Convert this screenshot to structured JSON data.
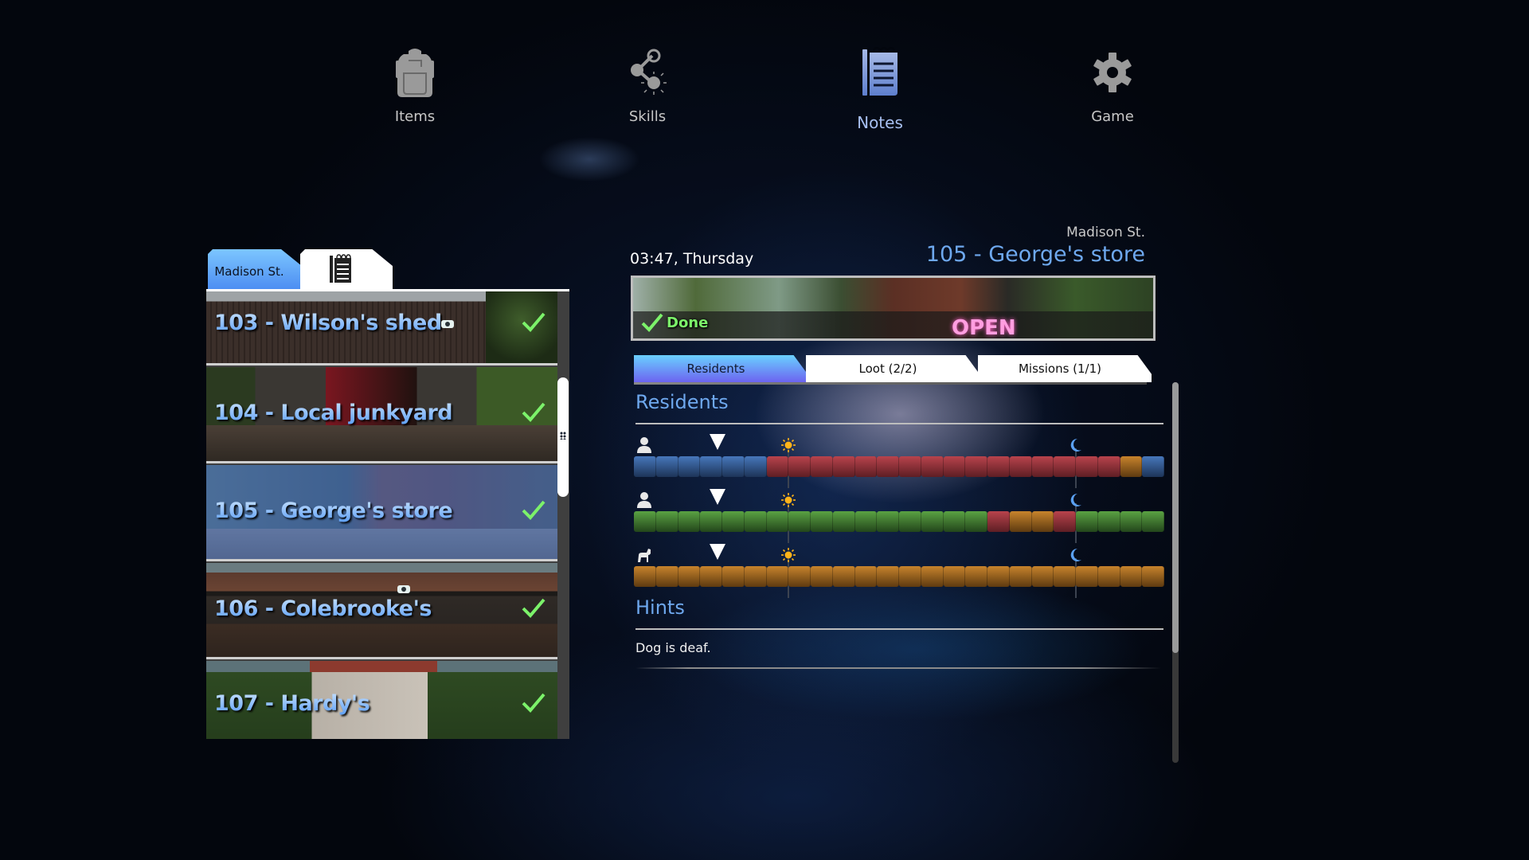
{
  "nav": {
    "items": [
      {
        "id": "items",
        "label": "Items",
        "icon": "backpack-icon",
        "active": false
      },
      {
        "id": "skills",
        "label": "Skills",
        "icon": "share-nodes-icon",
        "active": false
      },
      {
        "id": "notes",
        "label": "Notes",
        "icon": "notepad-icon",
        "active": true
      },
      {
        "id": "game",
        "label": "Game",
        "icon": "gear-icon",
        "active": false
      }
    ],
    "colors": {
      "inactive": "#9a9a9a",
      "active": "#7b9de0"
    }
  },
  "left_panel": {
    "tabs": [
      {
        "label": "Madison St.",
        "active": true
      },
      {
        "icon": "notepad-icon",
        "active": false
      }
    ],
    "locations": [
      {
        "label": "103 - Wilson's shed",
        "done": true,
        "selected": false,
        "has_camera": true
      },
      {
        "label": "104 - Local junkyard",
        "done": true,
        "selected": false,
        "has_camera": false
      },
      {
        "label": "105 - George's store",
        "done": true,
        "selected": true,
        "has_camera": false
      },
      {
        "label": "106 - Colebrooke's",
        "done": true,
        "selected": false,
        "has_camera": true
      },
      {
        "label": "107 - Hardy's",
        "done": true,
        "selected": false,
        "has_camera": false
      }
    ],
    "scroll_position": 0.3
  },
  "detail": {
    "time": "03:47, Thursday",
    "street": "Madison St.",
    "title": "105 - George's store",
    "status": "Done",
    "tabs": [
      {
        "label": "Residents",
        "active": true
      },
      {
        "label": "Loot (2/2)",
        "active": false
      },
      {
        "label": "Missions (1/1)",
        "active": false
      }
    ],
    "residents_heading": "Residents",
    "schedule": {
      "hours": 24,
      "current_hour": 3.78,
      "sunrise_hour": 7,
      "sunset_hour": 20,
      "state_colors": {
        "home": "#4777bb",
        "awake": "#b8434c",
        "alert": "#c7832c",
        "asleep": "#5aa243"
      },
      "residents": [
        {
          "type": "person",
          "icon": "person-icon",
          "states": [
            "home",
            "home",
            "home",
            "home",
            "home",
            "home",
            "awake",
            "awake",
            "awake",
            "awake",
            "awake",
            "awake",
            "awake",
            "awake",
            "awake",
            "awake",
            "awake",
            "awake",
            "awake",
            "awake",
            "awake",
            "awake",
            "alert",
            "home"
          ]
        },
        {
          "type": "person",
          "icon": "person-icon",
          "states": [
            "asleep",
            "asleep",
            "asleep",
            "asleep",
            "asleep",
            "asleep",
            "asleep",
            "asleep",
            "asleep",
            "asleep",
            "asleep",
            "asleep",
            "asleep",
            "asleep",
            "asleep",
            "asleep",
            "awake",
            "alert",
            "alert",
            "awake",
            "asleep",
            "asleep",
            "asleep",
            "asleep"
          ]
        },
        {
          "type": "dog",
          "icon": "dog-icon",
          "states": [
            "alert",
            "alert",
            "alert",
            "alert",
            "alert",
            "alert",
            "alert",
            "alert",
            "alert",
            "alert",
            "alert",
            "alert",
            "alert",
            "alert",
            "alert",
            "alert",
            "alert",
            "alert",
            "alert",
            "alert",
            "alert",
            "alert",
            "alert",
            "alert"
          ]
        }
      ]
    },
    "hints_heading": "Hints",
    "hints": [
      "Dog is deaf."
    ],
    "scroll_position": 0.0
  }
}
